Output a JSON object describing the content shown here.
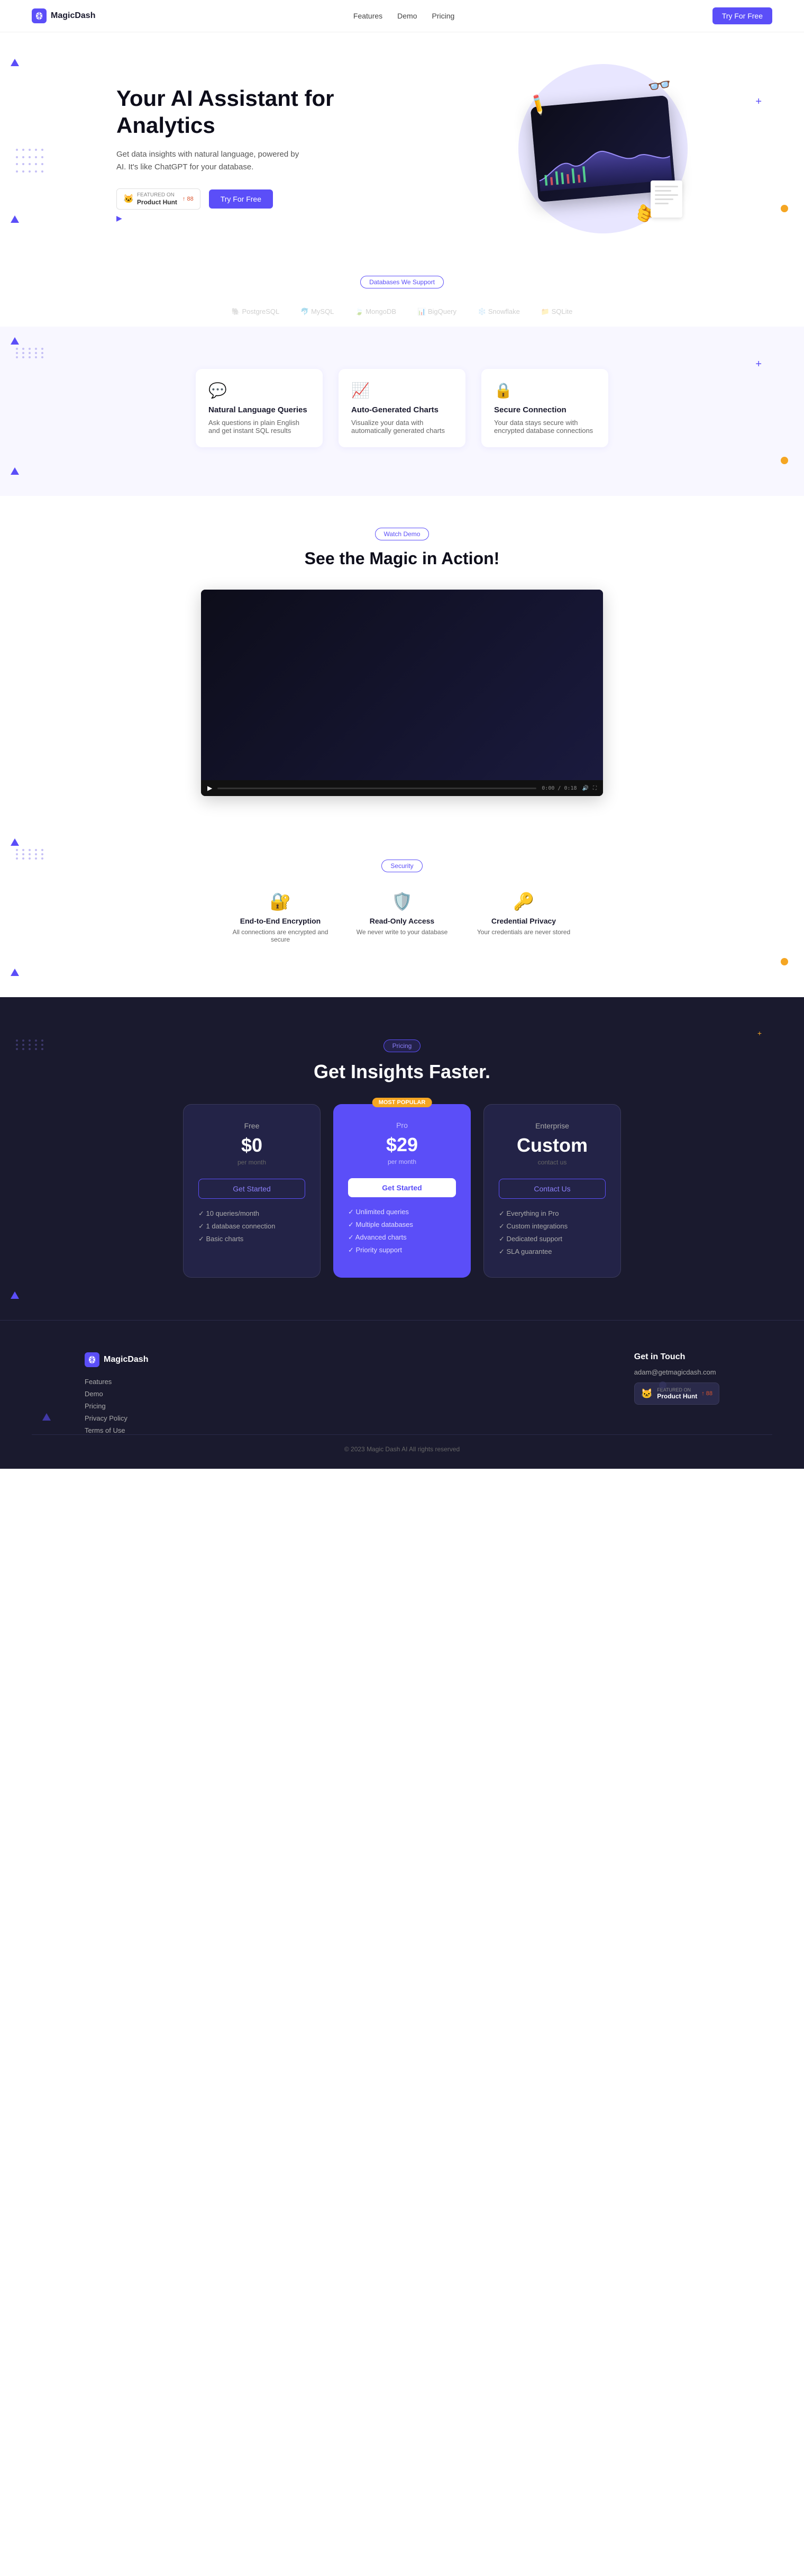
{
  "brand": {
    "name": "MagicDash",
    "logo_symbol": "🔮"
  },
  "nav": {
    "links": [
      {
        "label": "Features",
        "href": "#features"
      },
      {
        "label": "Demo",
        "href": "#demo"
      },
      {
        "label": "Pricing",
        "href": "#pricing"
      }
    ],
    "cta": "Try For Free"
  },
  "hero": {
    "title": "Your AI Assistant for Analytics",
    "description": "Get data insights with natural language, powered by AI. It's like ChatGPT for your database.",
    "cta_label": "Try For Free",
    "ph_label_featured": "FEATURED ON",
    "ph_name": "Product Hunt",
    "ph_score": "↑ 88"
  },
  "databases": {
    "section_label": "Databases We Support"
  },
  "demo": {
    "section_label": "Watch Demo",
    "title": "See the Magic in Action!",
    "time_current": "0:00",
    "time_total": "0:18"
  },
  "security": {
    "section_label": "Security"
  },
  "pricing": {
    "section_label": "Pricing",
    "title": "Get Insights Faster."
  },
  "footer": {
    "brand": "MagicDash",
    "links": [
      {
        "label": "Features"
      },
      {
        "label": "Demo"
      },
      {
        "label": "Pricing"
      },
      {
        "label": "Privacy Policy"
      },
      {
        "label": "Terms of Use"
      }
    ],
    "contact": {
      "title": "Get in Touch",
      "email": "adam@getmagicdash.com",
      "ph_label_featured": "FEATURED ON",
      "ph_name": "Product Hunt",
      "ph_score": "↑ 88"
    },
    "copyright": "© 2023 Magic Dash AI All rights reserved"
  }
}
